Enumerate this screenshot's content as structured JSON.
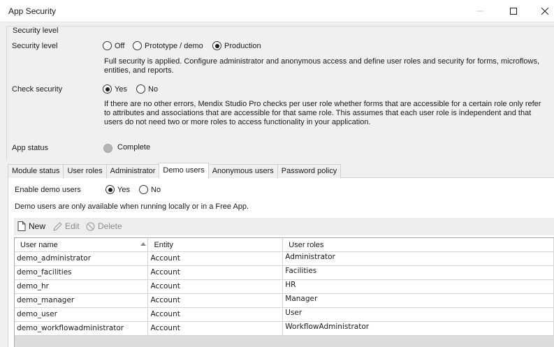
{
  "window": {
    "title": "App Security"
  },
  "security_group": {
    "legend": "Security level",
    "security_level_label": "Security level",
    "level_options": [
      "Off",
      "Prototype / demo",
      "Production"
    ],
    "selected_level": "Production",
    "level_description": "Full security is applied. Configure administrator and anonymous access and define user roles and security for forms, microflows, entities, and reports.",
    "check_security_label": "Check security",
    "check_options": [
      "Yes",
      "No"
    ],
    "check_selected": "Yes",
    "check_description": "If there are no other errors, Mendix Studio Pro checks per user role whether forms that are accessible for a certain role only refer to attributes and associations that are accessible for that same role. This assumes that each user role is independent and that users do not need two or more roles to access functionality in your application.",
    "app_status_label": "App status",
    "app_status_value": "Complete"
  },
  "tabs": [
    "Module status",
    "User roles",
    "Administrator",
    "Demo users",
    "Anonymous users",
    "Password policy"
  ],
  "active_tab": "Demo users",
  "demo_users": {
    "enable_label": "Enable demo users",
    "enable_options": [
      "Yes",
      "No"
    ],
    "enable_selected": "Yes",
    "info": "Demo users are only available when running locally or in a Free App.",
    "toolbar": {
      "new": "New",
      "edit": "Edit",
      "delete": "Delete"
    },
    "columns": [
      "User name",
      "Entity",
      "User roles"
    ],
    "rows": [
      [
        "demo_administrator",
        "Account",
        "Administrator"
      ],
      [
        "demo_facilities",
        "Account",
        "Facilities"
      ],
      [
        "demo_hr",
        "Account",
        "HR"
      ],
      [
        "demo_manager",
        "Account",
        "Manager"
      ],
      [
        "demo_user",
        "Account",
        "User"
      ],
      [
        "demo_workflowadministrator",
        "Account",
        "WorkflowAdministrator"
      ]
    ]
  },
  "colors": {
    "window_bg": "#f0f0f0",
    "panel_bg": "#ffffff",
    "toolbar_bg": "#ededed",
    "status_gray": "#b5b5b5"
  }
}
